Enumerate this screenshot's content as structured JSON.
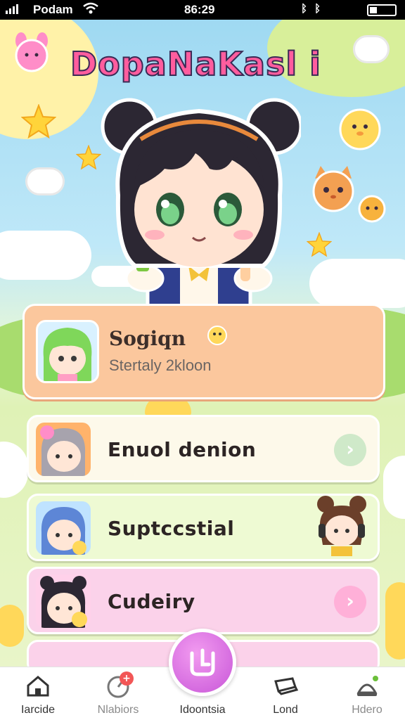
{
  "status_bar": {
    "carrier": "Podam",
    "time": "86:29",
    "system_icons": "ᛒ ᛒ"
  },
  "app": {
    "title": "DopaNaKasl i"
  },
  "featured": {
    "name": "Sogiqn",
    "subtitle": "Stertaly 2kloon"
  },
  "list": [
    {
      "label": "Enuol denion",
      "color": "#fdf9ea",
      "chevron_color": "#cfe9c9"
    },
    {
      "label": "Suptccstial",
      "color": "#eefad3"
    },
    {
      "label": "Cudeiry",
      "color": "#fbd2ea",
      "chevron_color": "#ffb0d8"
    }
  ],
  "tabs": [
    {
      "label": "Iarcide",
      "icon": "home-icon"
    },
    {
      "label": "Nlabiors",
      "icon": "timer-icon",
      "badge": "+"
    },
    {
      "label": "Idoontsia",
      "icon": "center-action-icon"
    },
    {
      "label": "Lond",
      "icon": "card-icon"
    },
    {
      "label": "Hdero",
      "icon": "hat-icon"
    }
  ]
}
